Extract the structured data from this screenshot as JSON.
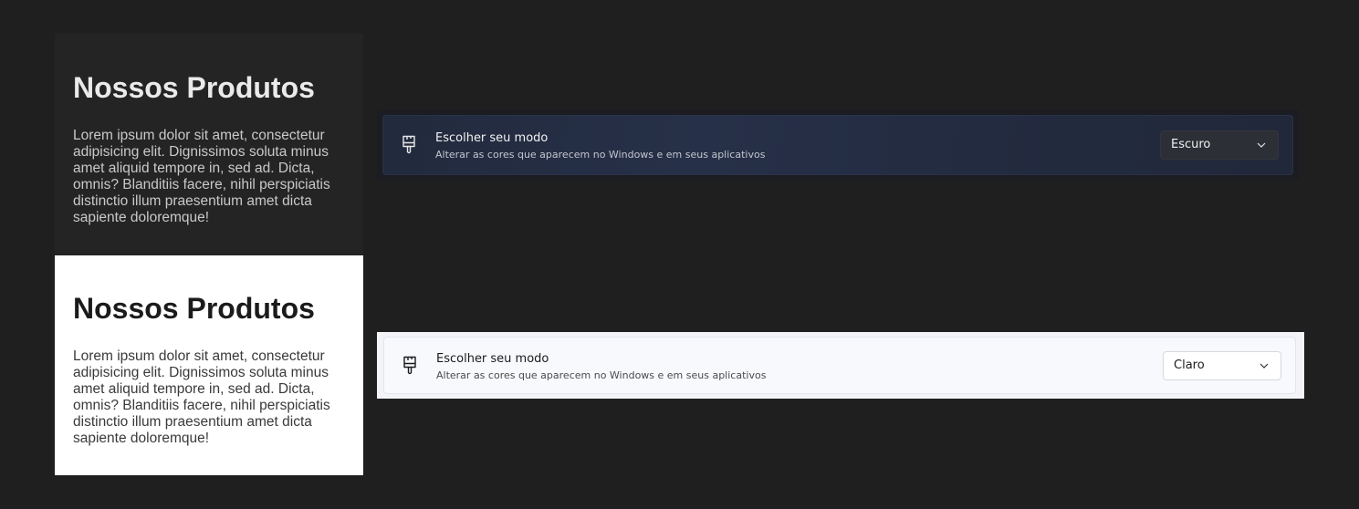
{
  "cards": {
    "dark": {
      "title": "Nossos Produtos",
      "body": "Lorem ipsum dolor sit amet, consectetur adipisicing elit. Dignissimos soluta minus amet aliquid tempore in, sed ad. Dicta, omnis? Blanditiis facere, nihil perspiciatis distinctio illum praesentium amet dicta sapiente doloremque!"
    },
    "light": {
      "title": "Nossos Produtos",
      "body": "Lorem ipsum dolor sit amet, consectetur adipisicing elit. Dignissimos soluta minus amet aliquid tempore in, sed ad. Dicta, omnis? Blanditiis facere, nihil perspiciatis distinctio illum praesentium amet dicta sapiente doloremque!"
    }
  },
  "settings": {
    "dark": {
      "icon": "paintbrush-icon",
      "title": "Escolher seu modo",
      "subtitle": "Alterar as cores que aparecem no Windows e em seus aplicativos",
      "dropdown_value": "Escuro"
    },
    "light": {
      "icon": "paintbrush-icon",
      "title": "Escolher seu modo",
      "subtitle": "Alterar as cores que aparecem no Windows e em seus aplicativos",
      "dropdown_value": "Claro"
    }
  },
  "colors": {
    "page_background": "#1f1f1f",
    "dark_card": "#242424",
    "light_card": "#ffffff",
    "dark_setting_row": "#263048",
    "light_setting_row": "#f8f9fd"
  }
}
